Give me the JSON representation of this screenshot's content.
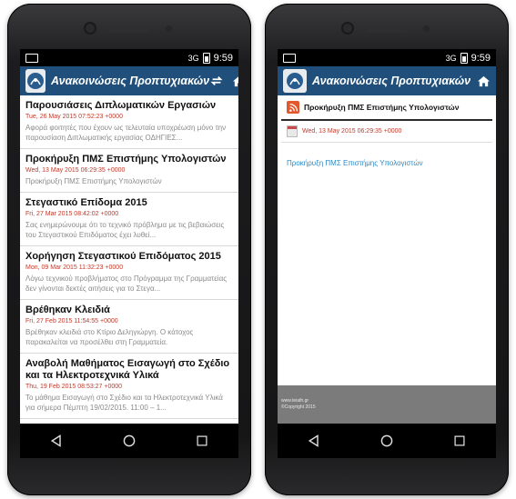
{
  "status": {
    "time": "9:59",
    "network": "3G"
  },
  "app": {
    "title": "Ανακοινώσεις Προπτυχιακών"
  },
  "list": [
    {
      "title": "Παρουσιάσεις Διπλωματικών Εργασιών",
      "date": "Tue, 26 May 2015 07:52:23 +0000",
      "desc": "Αφορά φοιτητές που έχουν ως τελευταία υποχρέωση μόνο την παρουσίαση Διπλωματικής εργασίας ΟΔΗΓΙΕΣ..."
    },
    {
      "title": "Προκήρυξη ΠΜΣ Επιστήμης Υπολογιστών",
      "date": "Wed, 13 May 2015 06:29:35 +0000",
      "desc": "Προκήρυξη ΠΜΣ Επιστήμης Υπολογιστών"
    },
    {
      "title": "Στεγαστικό Επίδομα 2015",
      "date": "Fri, 27 Mar 2015 08:42:02 +0000",
      "desc": "Σας ενημερώνουμε ότι το τεχνικό πρόβλημα με τις βεβαιώσεις του Στεγαστικού Επιδόματος έχει λυθεί..."
    },
    {
      "title": "Χορήγηση Στεγαστικού Επιδόματος 2015",
      "date": "Mon, 09 Mar 2015 11:32:23 +0000",
      "desc": "Λόγω τεχνικού προβλήματος στο Πρόγραμμα της Γραμματείας δεν γίνονται δεκτές αιτήσεις για το Στεγα..."
    },
    {
      "title": "Βρέθηκαν Κλειδιά",
      "date": "Fri, 27 Feb 2015 11:54:55 +0000",
      "desc": "Βρέθηκαν κλειδιά στο Κτίριο Δεληγιώργη. Ο κάτοχος παρακαλείται να προσέλθει στη Γραμματεία."
    },
    {
      "title": "Αναβολή Μαθήματος Εισαγωγή στο Σχέδιο και τα Ηλεκτροτεχνικά Υλικά",
      "date": "Thu, 19 Feb 2015 08:53:27 +0000",
      "desc": "Το μάθημα Εισαγωγή στο Σχέδιο και τα Ηλεκτροτεχνικά Υλικά για σήμερα Πέμπτη 19/02/2015. 11:00 – 1..."
    }
  ],
  "detail": {
    "title": "Προκήρυξη ΠΜΣ Επιστήμης Υπολογιστών",
    "date": "Wed, 13 May 2015 06:29:35 +0000",
    "body": "Προκήρυξη ΠΜΣ Επιστήμης Υπολογιστών",
    "footer_line1": "www.teiath.gr",
    "footer_line2": "©Copyright 2015"
  },
  "colors": {
    "appbar": "#1f4f7a",
    "date": "#c0392b",
    "link": "#2a8ac4",
    "rss": "#e2572b"
  },
  "icons": [
    "refresh-icon",
    "home-icon",
    "back-icon",
    "home-nav-icon",
    "recents-icon",
    "rss-icon",
    "calendar-icon"
  ]
}
